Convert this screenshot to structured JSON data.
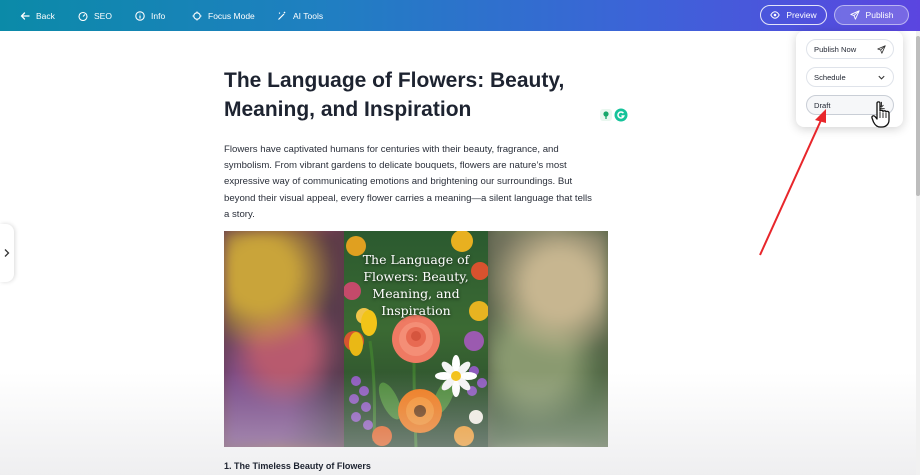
{
  "toolbar": {
    "back_label": "Back",
    "seo_label": "SEO",
    "info_label": "Info",
    "focus_label": "Focus Mode",
    "ai_label": "AI Tools",
    "preview_label": "Preview",
    "publish_label": "Publish"
  },
  "publish_menu": {
    "publish_now_label": "Publish Now",
    "schedule_label": "Schedule",
    "draft_label": "Draft"
  },
  "article": {
    "title_line1": "The Language of Flowers: Beauty,",
    "title_line2": "Meaning, and Inspiration",
    "intro_lines": [
      "Flowers have captivated humans for centuries with their beauty, fragrance, and",
      "symbolism. From vibrant gardens to delicate bouquets, flowers are nature’s most",
      "expressive way of communicating emotions and brightening our surroundings. But",
      "beyond their visual appeal, every flower carries a meaning—a silent language that tells",
      "a story."
    ],
    "hero_caption_lines": [
      "The Language of",
      "Flowers: Beauty,",
      "Meaning, and",
      "Inspiration"
    ],
    "section_heading": "1. The Timeless Beauty of Flowers"
  },
  "colors": {
    "toolbar_gradient_start": "#0b8aa8",
    "toolbar_gradient_end": "#5b45e0",
    "annotation_arrow": "#e8262b"
  },
  "icons": [
    "arrow-left-icon",
    "gauge-icon",
    "info-icon",
    "focus-icon",
    "magic-wand-icon",
    "eye-icon",
    "send-icon",
    "chevron-down-icon",
    "download-icon",
    "hand-cursor-icon",
    "chevron-right-icon",
    "grammarly-icon"
  ]
}
